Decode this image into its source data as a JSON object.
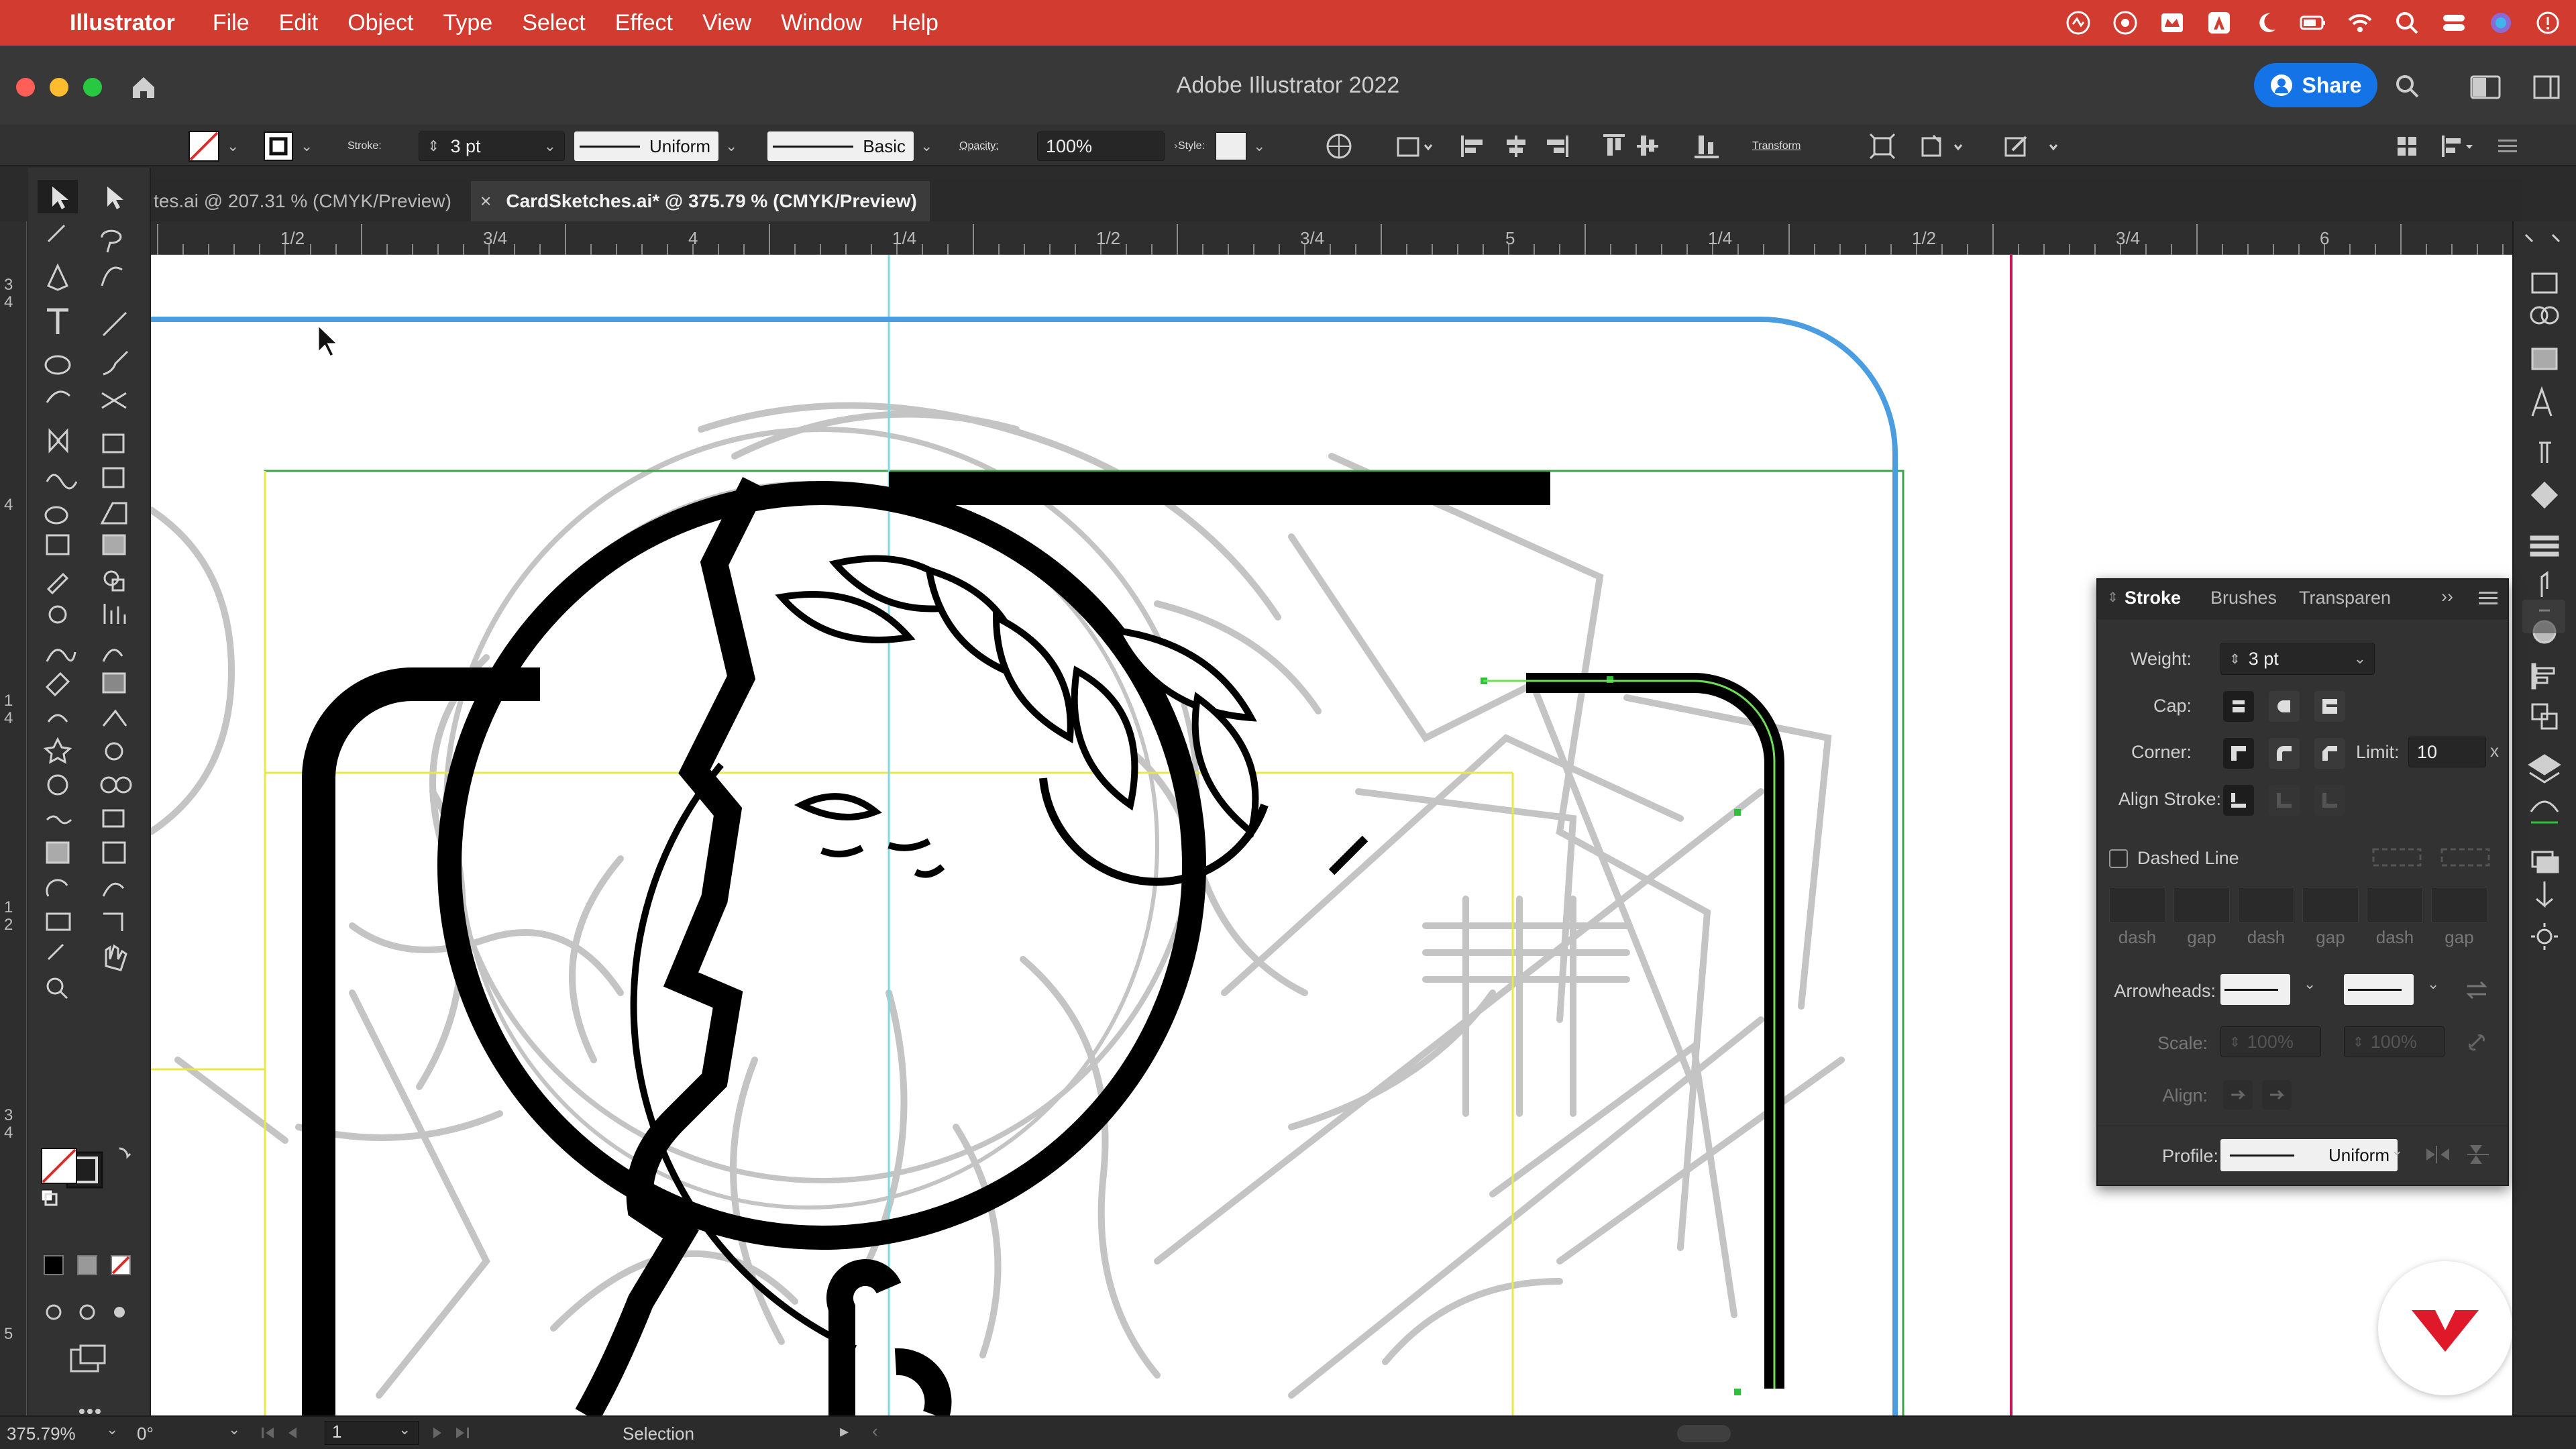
{
  "menubar": {
    "app_name": "Illustrator",
    "items": [
      "File",
      "Edit",
      "Object",
      "Type",
      "Select",
      "Effect",
      "View",
      "Window",
      "Help"
    ]
  },
  "window": {
    "title": "Adobe Illustrator 2022",
    "share_label": "Share"
  },
  "controlbar": {
    "stroke_label": "Stroke:",
    "stroke_value": "3 pt",
    "profile_value": "Uniform",
    "brush_value": "Basic",
    "opacity_label": "Opacity:",
    "opacity_value": "100%",
    "style_label": "Style:",
    "transform_label": "Transform"
  },
  "tabs": [
    {
      "label": "tes.ai @ 207.31 % (CMYK/Preview)",
      "active": false
    },
    {
      "label": "CardSketches.ai* @ 375.79 % (CMYK/Preview)",
      "active": true
    }
  ],
  "ruler_h": [
    "1/2",
    "3/4",
    "4",
    "1/4",
    "1/2",
    "3/4",
    "5",
    "1/4",
    "1/2",
    "3/4",
    "6"
  ],
  "ruler_v": [
    "3\n4",
    "4",
    "1\n4",
    "1\n2",
    "3\n4",
    "5"
  ],
  "stroke_panel": {
    "tabs": [
      "Stroke",
      "Brushes",
      "Transparen"
    ],
    "weight_label": "Weight:",
    "weight_value": "3 pt",
    "cap_label": "Cap:",
    "corner_label": "Corner:",
    "limit_label": "Limit:",
    "limit_value": "10",
    "align_label": "Align Stroke:",
    "dashed_label": "Dashed Line",
    "dash_labels": [
      "dash",
      "gap",
      "dash",
      "gap",
      "dash",
      "gap"
    ],
    "arrowheads_label": "Arrowheads:",
    "scale_label": "Scale:",
    "scale_value_1": "100%",
    "scale_value_2": "100%",
    "align_arrow_label": "Align:",
    "profile_label": "Profile:",
    "profile_value": "Uniform"
  },
  "statusbar": {
    "zoom": "375.79%",
    "rotation": "0°",
    "artboard": "1",
    "tool": "Selection"
  },
  "colors": {
    "menubar": "#d13b30",
    "accent": "#1473e6",
    "artboard_edge": "#4a9de0",
    "bleed": "#c2185b"
  }
}
